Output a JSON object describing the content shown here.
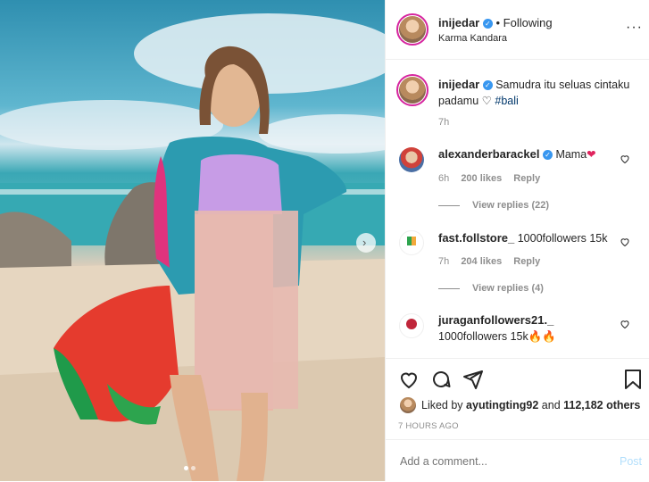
{
  "post": {
    "username": "inijedar",
    "following_label": "• Following",
    "location": "Karma Kandara",
    "caption_text": "Samudra itu seluas cintaku padamu",
    "caption_heart": "♡",
    "caption_tag": "#bali",
    "caption_time": "7h"
  },
  "comments": [
    {
      "user": "alexanderbarackel",
      "verified": true,
      "text": "Mama",
      "emoji": "❤",
      "time": "6h",
      "likes": "200 likes",
      "reply": "Reply",
      "view_replies": "View replies (22)"
    },
    {
      "user": "fast.follstore_",
      "text": "1000followers 15k",
      "time": "7h",
      "likes": "204 likes",
      "reply": "Reply",
      "view_replies": "View replies (4)"
    },
    {
      "user": "juraganfollowers21._",
      "text": "1000followers 15k🔥🔥"
    }
  ],
  "likes": {
    "prefix": "Liked by",
    "user": "ayutingting92",
    "middle": "and",
    "count": "112,182 others"
  },
  "timestamp": "7 HOURS AGO",
  "comment_box": {
    "placeholder": "Add a comment...",
    "post_label": "Post"
  },
  "icons": {
    "like": "heart-outline-icon",
    "comment": "comment-bubble-icon",
    "share": "paper-plane-icon",
    "save": "bookmark-icon",
    "more": "more-icon",
    "next": "chevron-right-icon"
  },
  "colors": {
    "link": "#00376b",
    "tag": "#00376b",
    "post_button": "#b2dffc",
    "verified": "#3897f0"
  }
}
